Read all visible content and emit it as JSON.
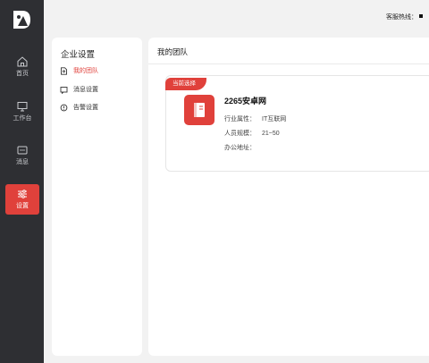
{
  "nav": {
    "items": [
      {
        "label": "首页",
        "icon": "home-icon"
      },
      {
        "label": "工作台",
        "icon": "monitor-icon"
      },
      {
        "label": "消息",
        "icon": "message-icon"
      },
      {
        "label": "设置",
        "icon": "sliders-icon",
        "active": true
      }
    ]
  },
  "header": {
    "hotline_label": "客服热线："
  },
  "settings": {
    "title": "企业设置",
    "menu": [
      {
        "label": "我的团队",
        "icon": "team-doc-icon",
        "active": true
      },
      {
        "label": "消息设置",
        "icon": "message-square-icon"
      },
      {
        "label": "告警设置",
        "icon": "bell-alert-icon"
      }
    ]
  },
  "main": {
    "title": "我的团队",
    "card": {
      "tag": "当前选择",
      "name": "2265安卓网",
      "industry_label": "行业属性：",
      "industry_value": "IT互联网",
      "size_label": "人员规模：",
      "size_value": "21~50",
      "address_label": "办公地址：",
      "address_value": ""
    }
  },
  "colors": {
    "accent": "#e0413b",
    "nav_bg": "#2e2f33",
    "page_bg": "#f2f2f2"
  }
}
